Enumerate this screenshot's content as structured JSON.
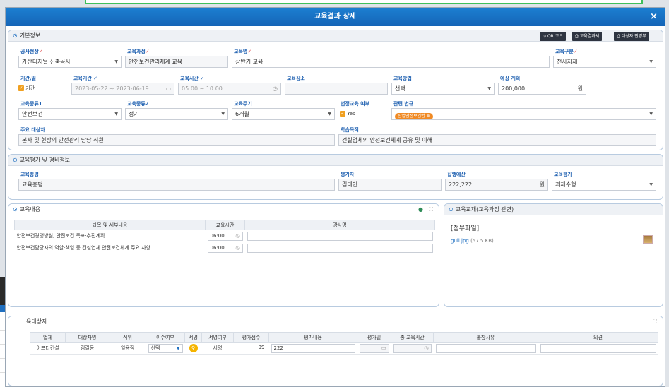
{
  "modal": {
    "title": "교육결과 상세",
    "close": "×"
  },
  "basic": {
    "section_title": "기본정보",
    "btn_qr": "QR 코드",
    "btn_result": "교육결과서",
    "btn_target": "대상자 안명부",
    "labels": {
      "site": "공사현장",
      "course": "교육과정",
      "name": "교육명",
      "type": "교육구분",
      "period_opt": "기간,일",
      "period": "교육기간",
      "time": "교육시간",
      "place": "교육장소",
      "method": "교육방법",
      "cost": "예상 계획",
      "kind1": "교육종류1",
      "kind2": "교육종류2",
      "cycle": "교육주기",
      "legal": "법정교육 여부",
      "law": "관련 법규",
      "target": "주요 대상자",
      "goal": "학습목적"
    },
    "values": {
      "site": "가산디지털 신축공사",
      "course": "안전보건관리체계 교육",
      "name": "상반기 교육",
      "type": "전사자체",
      "period_opt": "기간",
      "period": "2023-05-22 ~ 2023-06-19",
      "time": "05:00 ~ 10:00",
      "place": "",
      "method": "선택",
      "cost": "200,000",
      "cost_unit": "원",
      "kind1": "안전보건",
      "kind2": "정기",
      "cycle": "6개월",
      "legal": "Yes",
      "law_badge": "산업안전보건법",
      "target": "본사 및 현장의 안전관리 담당 직원",
      "goal": "건설업체의 안전보건체계 공유 및 이해"
    }
  },
  "eval": {
    "section_title": "교육평가 및 경비정보",
    "labels": {
      "overall": "교육총평",
      "evaluator": "평가자",
      "budget": "집행예산",
      "grade": "교육평가"
    },
    "values": {
      "overall": "교육총평",
      "evaluator": "김태인",
      "budget": "222,222",
      "budget_unit": "원",
      "grade": "과제수행"
    }
  },
  "content": {
    "section_title": "교육내용",
    "headers": [
      "과목 및 세부내용",
      "교육시간",
      "강사명"
    ],
    "rows": [
      {
        "subject": "안전보건경영방침, 안전보건 목표·추진계획",
        "time": "06:00",
        "teacher": ""
      },
      {
        "subject": "안전보건담당자의 역할·책임 등 건설업체 안전보건체계 주요 사항",
        "time": "06:00",
        "teacher": ""
      }
    ]
  },
  "material": {
    "section_title": "교육교재(교육과정 관련)",
    "attach_label": "[첨부파일]",
    "file": "gull.jpg",
    "file_size": "(57.5 KB)"
  },
  "attendees": {
    "section_title": "육대상자",
    "headers": [
      "업체",
      "대상자명",
      "직위",
      "이수여부",
      "서명",
      "서명여부",
      "평가점수",
      "평가내용",
      "평가일",
      "총 교육시간",
      "불참사유",
      "의견"
    ],
    "rows": [
      {
        "company": "이프티건설",
        "name": "김길동",
        "position": "일용직",
        "status": "선택",
        "signed": "서명",
        "score": "99",
        "comment": "222",
        "date": "",
        "hours": "",
        "reason": "",
        "opinion": ""
      }
    ]
  },
  "bg_window": {
    "close": "×"
  }
}
